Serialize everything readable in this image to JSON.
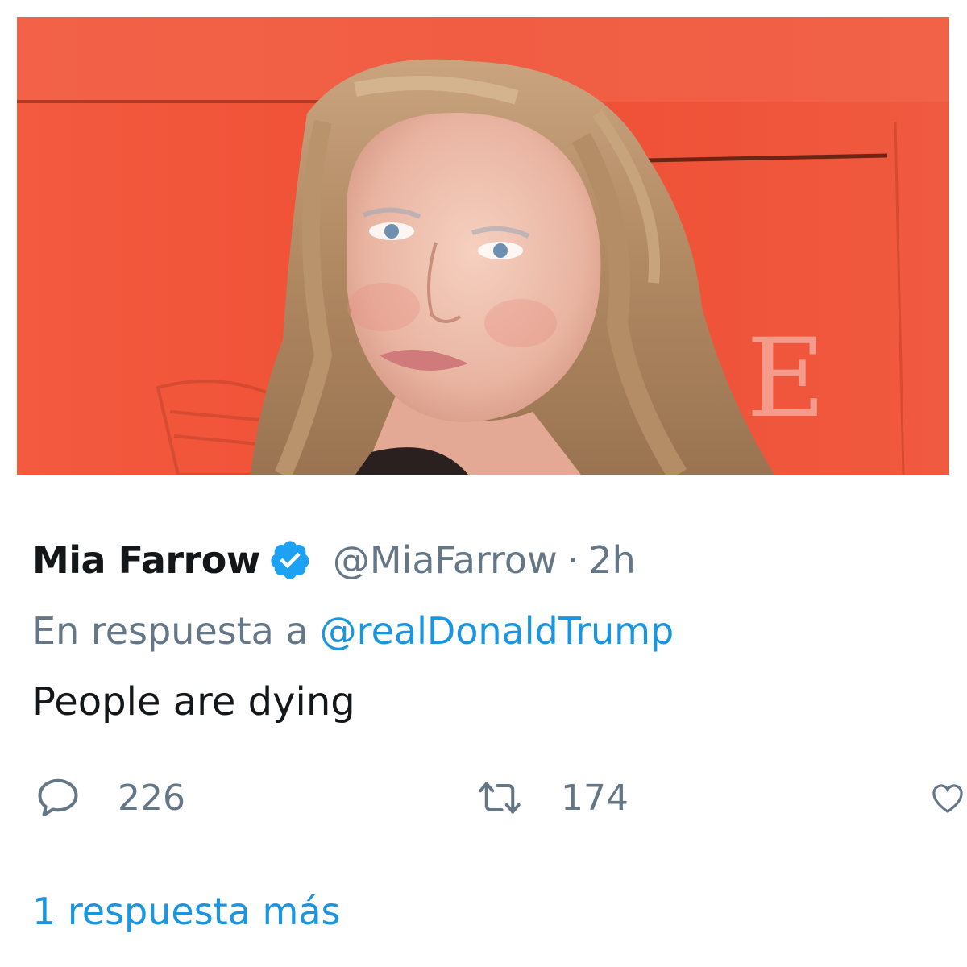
{
  "photo": {
    "image": "portrait-photo",
    "backdrop_color": "#f0543a",
    "backdrop_letter": "E"
  },
  "tweet": {
    "author_name": "Mia Farrow",
    "verified": true,
    "verified_icon": "verified-badge-icon",
    "handle": "@MiaFarrow",
    "separator": "·",
    "time": "2h",
    "reply_prefix": "En respuesta a",
    "reply_to": "@realDonaldTrump",
    "text": "People are dying",
    "colors": {
      "name": "#14171a",
      "secondary": "#657786",
      "link": "#1b95e0",
      "verified": "#1da1f2"
    }
  },
  "actions": {
    "replies": {
      "icon": "reply-icon",
      "count": "226"
    },
    "retweets": {
      "icon": "retweet-icon",
      "count": "174"
    },
    "likes": {
      "icon": "like-icon"
    }
  },
  "footer": {
    "more_replies": "1 respuesta más"
  }
}
